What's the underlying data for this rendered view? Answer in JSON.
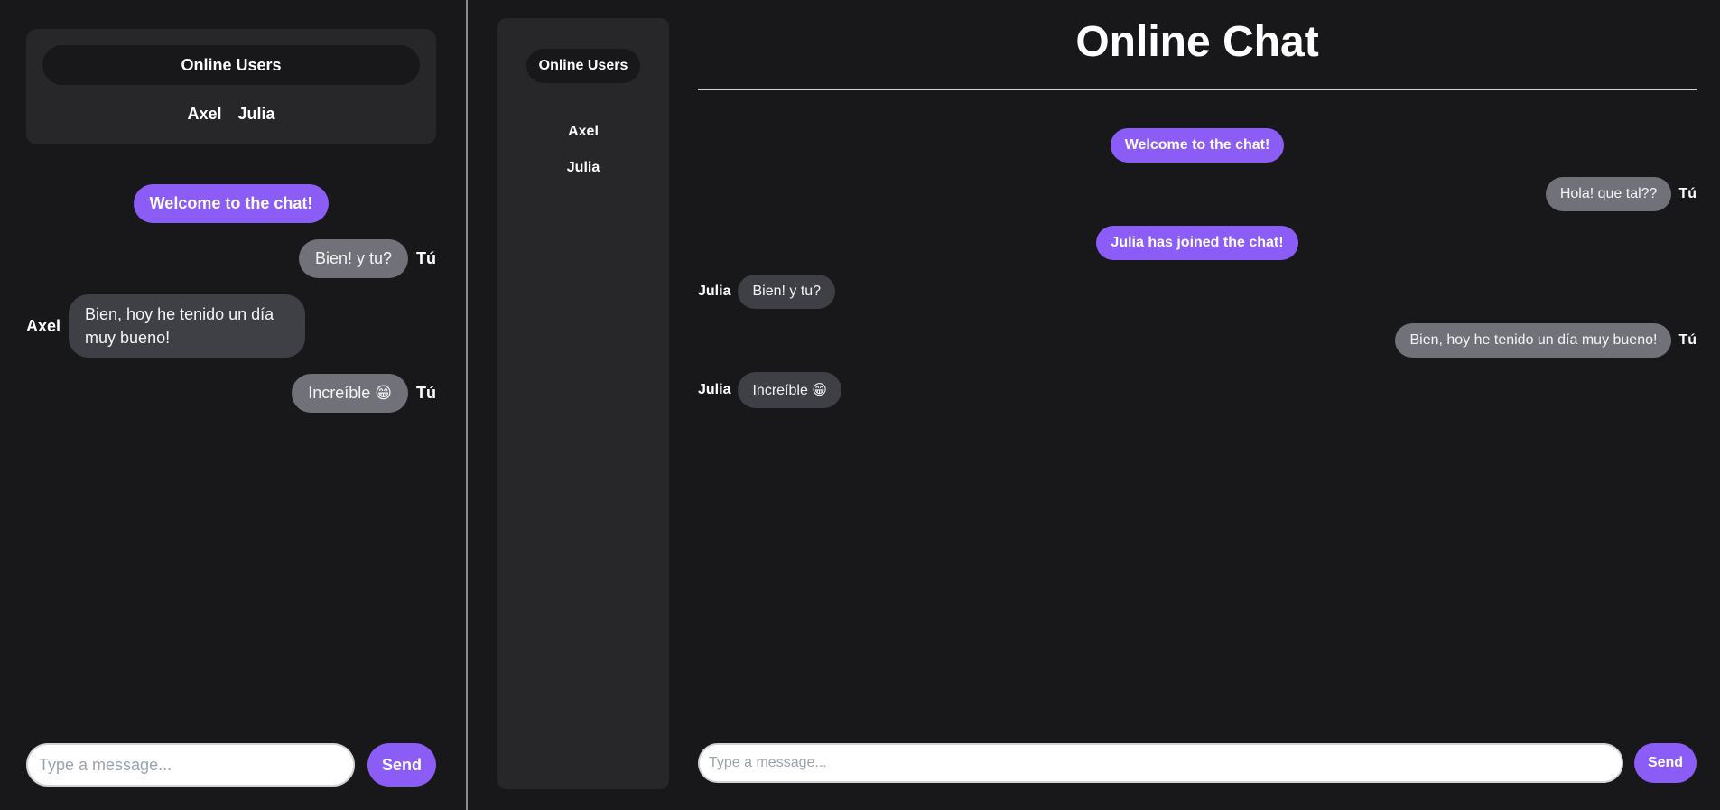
{
  "colors": {
    "background": "#18181b",
    "panel": "#27272a",
    "accent": "#8b5cf6",
    "my_bubble": "#71717a",
    "other_bubble": "#3f3f46"
  },
  "mobile": {
    "online_users_title": "Online Users",
    "users": [
      "Axel",
      "Julia"
    ],
    "messages": [
      {
        "kind": "system",
        "text": "Welcome to the chat!"
      },
      {
        "kind": "me",
        "author": "Tú",
        "text": "Bien! y tu?"
      },
      {
        "kind": "other",
        "author": "Axel",
        "text": "Bien, hoy he tenido un día muy bueno!"
      },
      {
        "kind": "me",
        "author": "Tú",
        "text": "Increíble 😁"
      }
    ],
    "input_placeholder": "Type a message...",
    "send_label": "Send"
  },
  "desktop": {
    "title": "Online Chat",
    "online_users_title": "Online Users",
    "users": [
      "Axel",
      "Julia"
    ],
    "messages": [
      {
        "kind": "system",
        "text": "Welcome to the chat!"
      },
      {
        "kind": "me",
        "author": "Tú",
        "text": "Hola! que tal??"
      },
      {
        "kind": "system",
        "text": "Julia has joined the chat!"
      },
      {
        "kind": "other",
        "author": "Julia",
        "text": "Bien! y tu?"
      },
      {
        "kind": "me",
        "author": "Tú",
        "text": "Bien, hoy he tenido un día muy bueno!"
      },
      {
        "kind": "other",
        "author": "Julia",
        "text": "Increíble 😁"
      }
    ],
    "input_placeholder": "Type a message...",
    "send_label": "Send"
  }
}
